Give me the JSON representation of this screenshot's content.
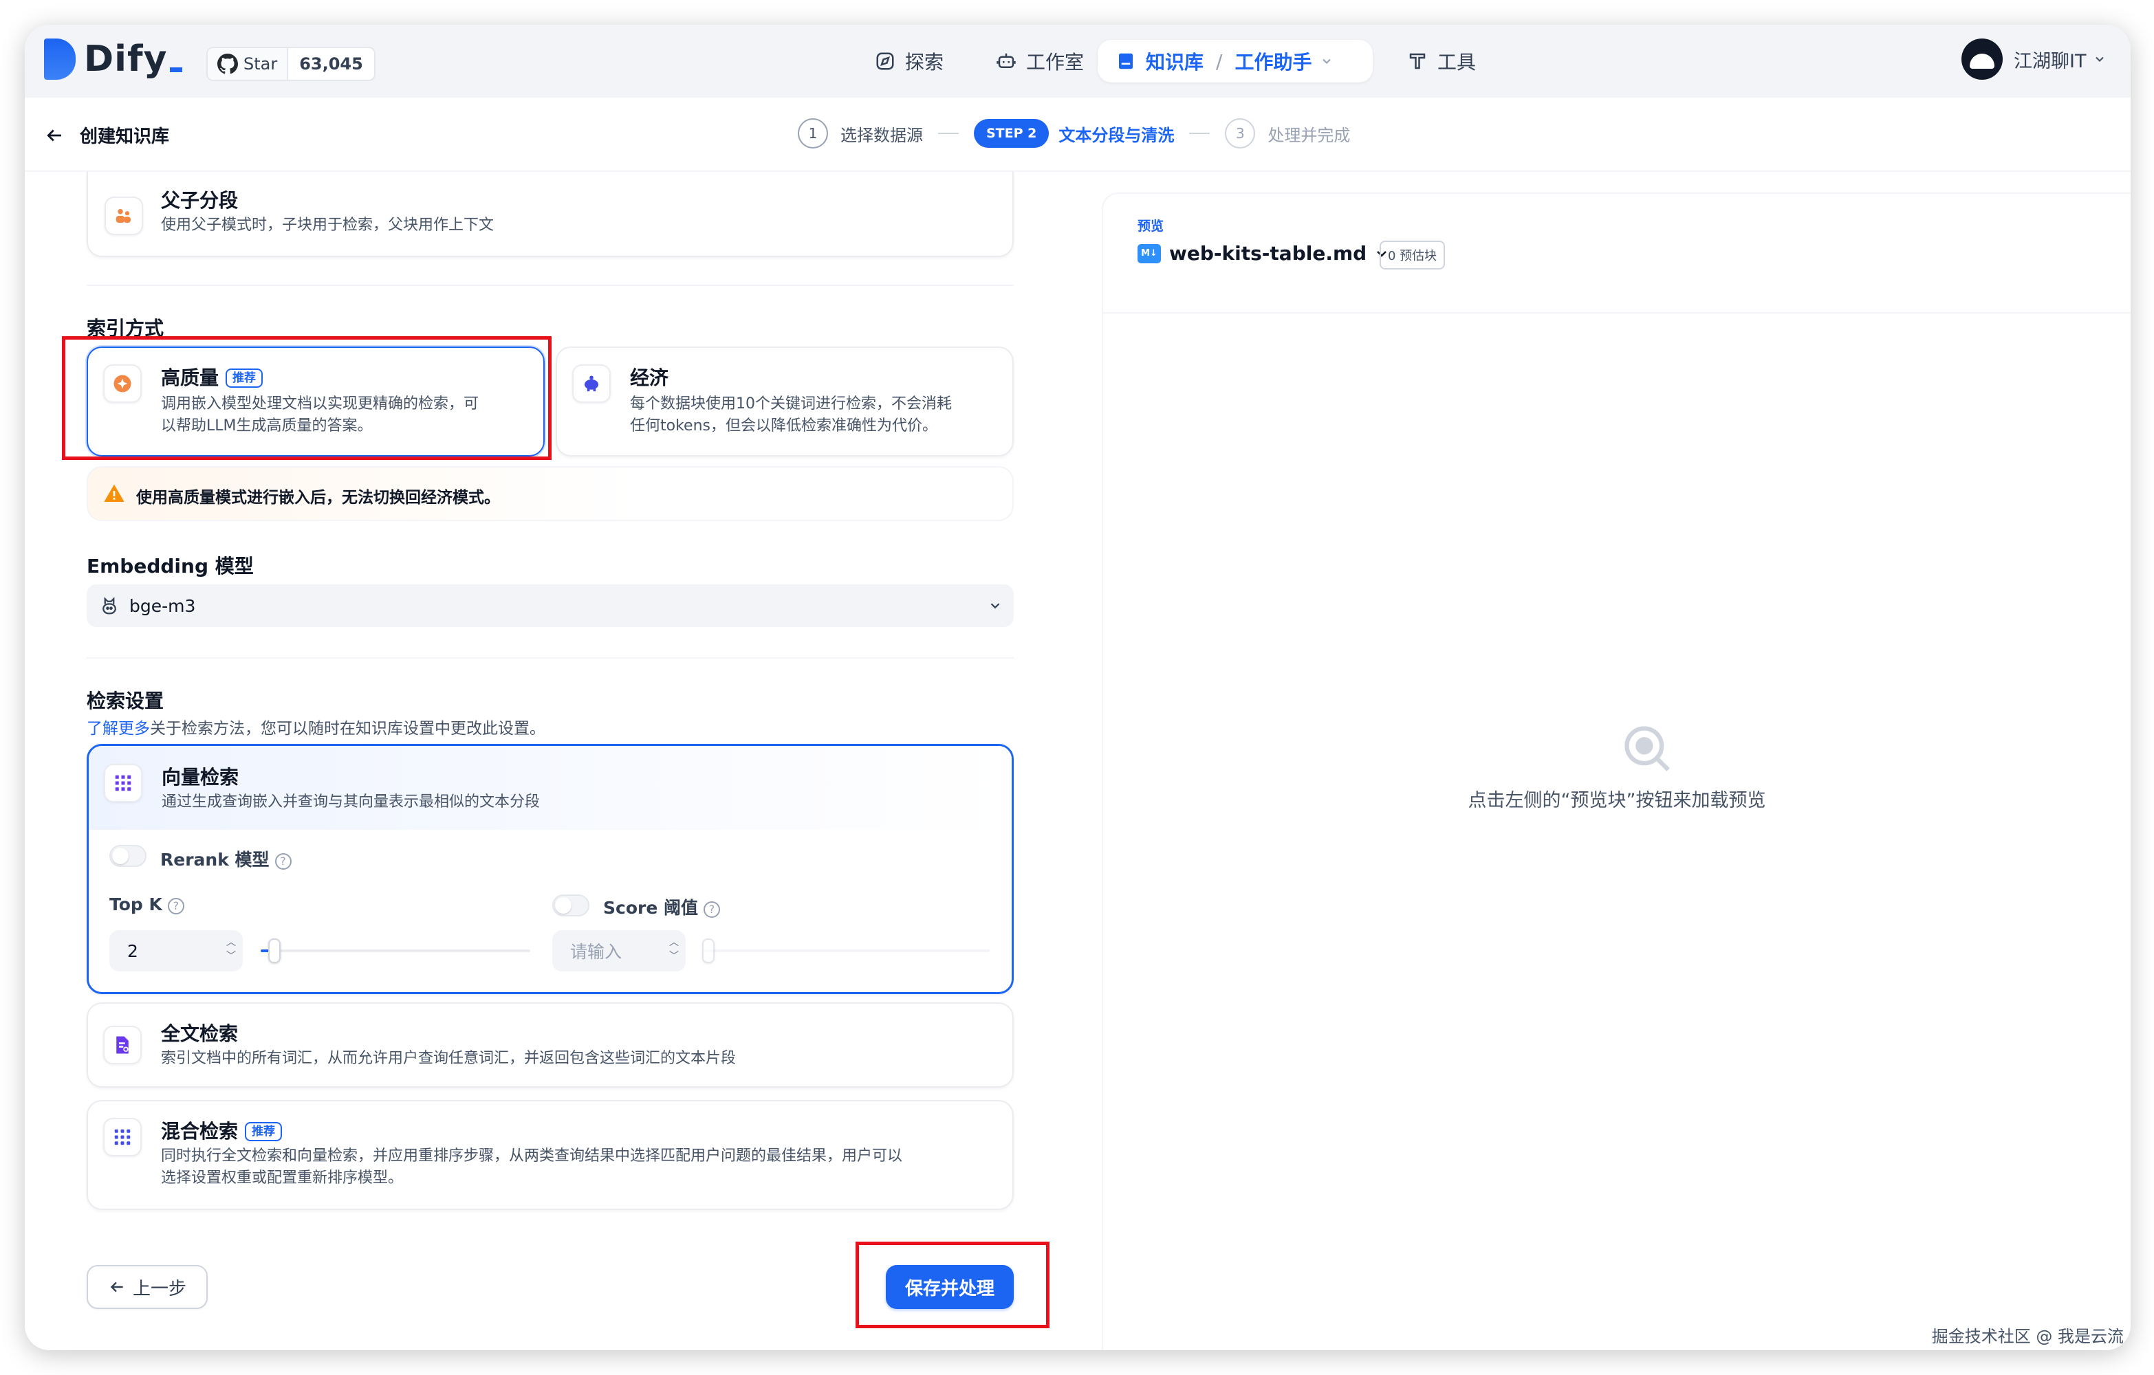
{
  "app": {
    "logo_text": "Dify",
    "github_label": "Star",
    "github_count": "63,045"
  },
  "nav": {
    "explore": "探索",
    "studio": "工作室",
    "knowledge": "知识库",
    "workspace_app": "工作助手",
    "tools": "工具"
  },
  "user": {
    "name": "江湖聊IT"
  },
  "page": {
    "title": "创建知识库"
  },
  "steps": [
    {
      "num": "1",
      "label": "选择数据源"
    },
    {
      "pill": "STEP 2",
      "label": "文本分段与清洗"
    },
    {
      "num": "3",
      "label": "处理并完成"
    }
  ],
  "parent_child": {
    "title": "父子分段",
    "desc": "使用父子模式时，子块用于检索，父块用作上下文"
  },
  "index": {
    "section_title": "索引方式",
    "high_quality": {
      "title": "高质量",
      "badge": "推荐",
      "desc1": "调用嵌入模型处理文档以实现更精确的检索，可",
      "desc2": "以帮助LLM生成高质量的答案。"
    },
    "economy": {
      "title": "经济",
      "desc1": "每个数据块使用10个关键词进行检索，不会消耗",
      "desc2": "任何tokens，但会以降低检索准确性为代价。"
    },
    "warning": "使用高质量模式进行嵌入后，无法切换回经济模式。"
  },
  "embedding": {
    "section_title": "Embedding 模型",
    "value": "bge-m3"
  },
  "retrieval": {
    "section_title": "检索设置",
    "learn_more": "了解更多",
    "hint": "关于检索方法，您可以随时在知识库设置中更改此设置。",
    "vector": {
      "title": "向量检索",
      "desc": "通过生成查询嵌入并查询与其向量表示最相似的文本分段"
    },
    "rerank_label": "Rerank 模型",
    "topk_label": "Top K",
    "topk_value": "2",
    "topk_fraction": 0.05,
    "score_label": "Score 阈值",
    "score_placeholder": "请输入",
    "fulltext": {
      "title": "全文检索",
      "desc": "索引文档中的所有词汇，从而允许用户查询任意词汇，并返回包含这些词汇的文本片段"
    },
    "hybrid": {
      "title": "混合检索",
      "badge": "推荐",
      "desc1": "同时执行全文检索和向量检索，并应用重排序步骤，从两类查询结果中选择匹配用户问题的最佳结果，用户可以",
      "desc2": "选择设置权重或配置重新排序模型。"
    }
  },
  "buttons": {
    "prev": "上一步",
    "save": "保存并处理"
  },
  "preview": {
    "label": "预览",
    "file": "web-kits-table.md",
    "md_icon": "M↓",
    "count": "0 预估块",
    "empty": "点击左侧的“预览块”按钮来加载预览"
  },
  "watermark": "掘金技术社区 @ 我是云流",
  "colors": {
    "accent": "#1c64f2",
    "highlight_box": "#e8101a",
    "warning": "#f79009"
  }
}
